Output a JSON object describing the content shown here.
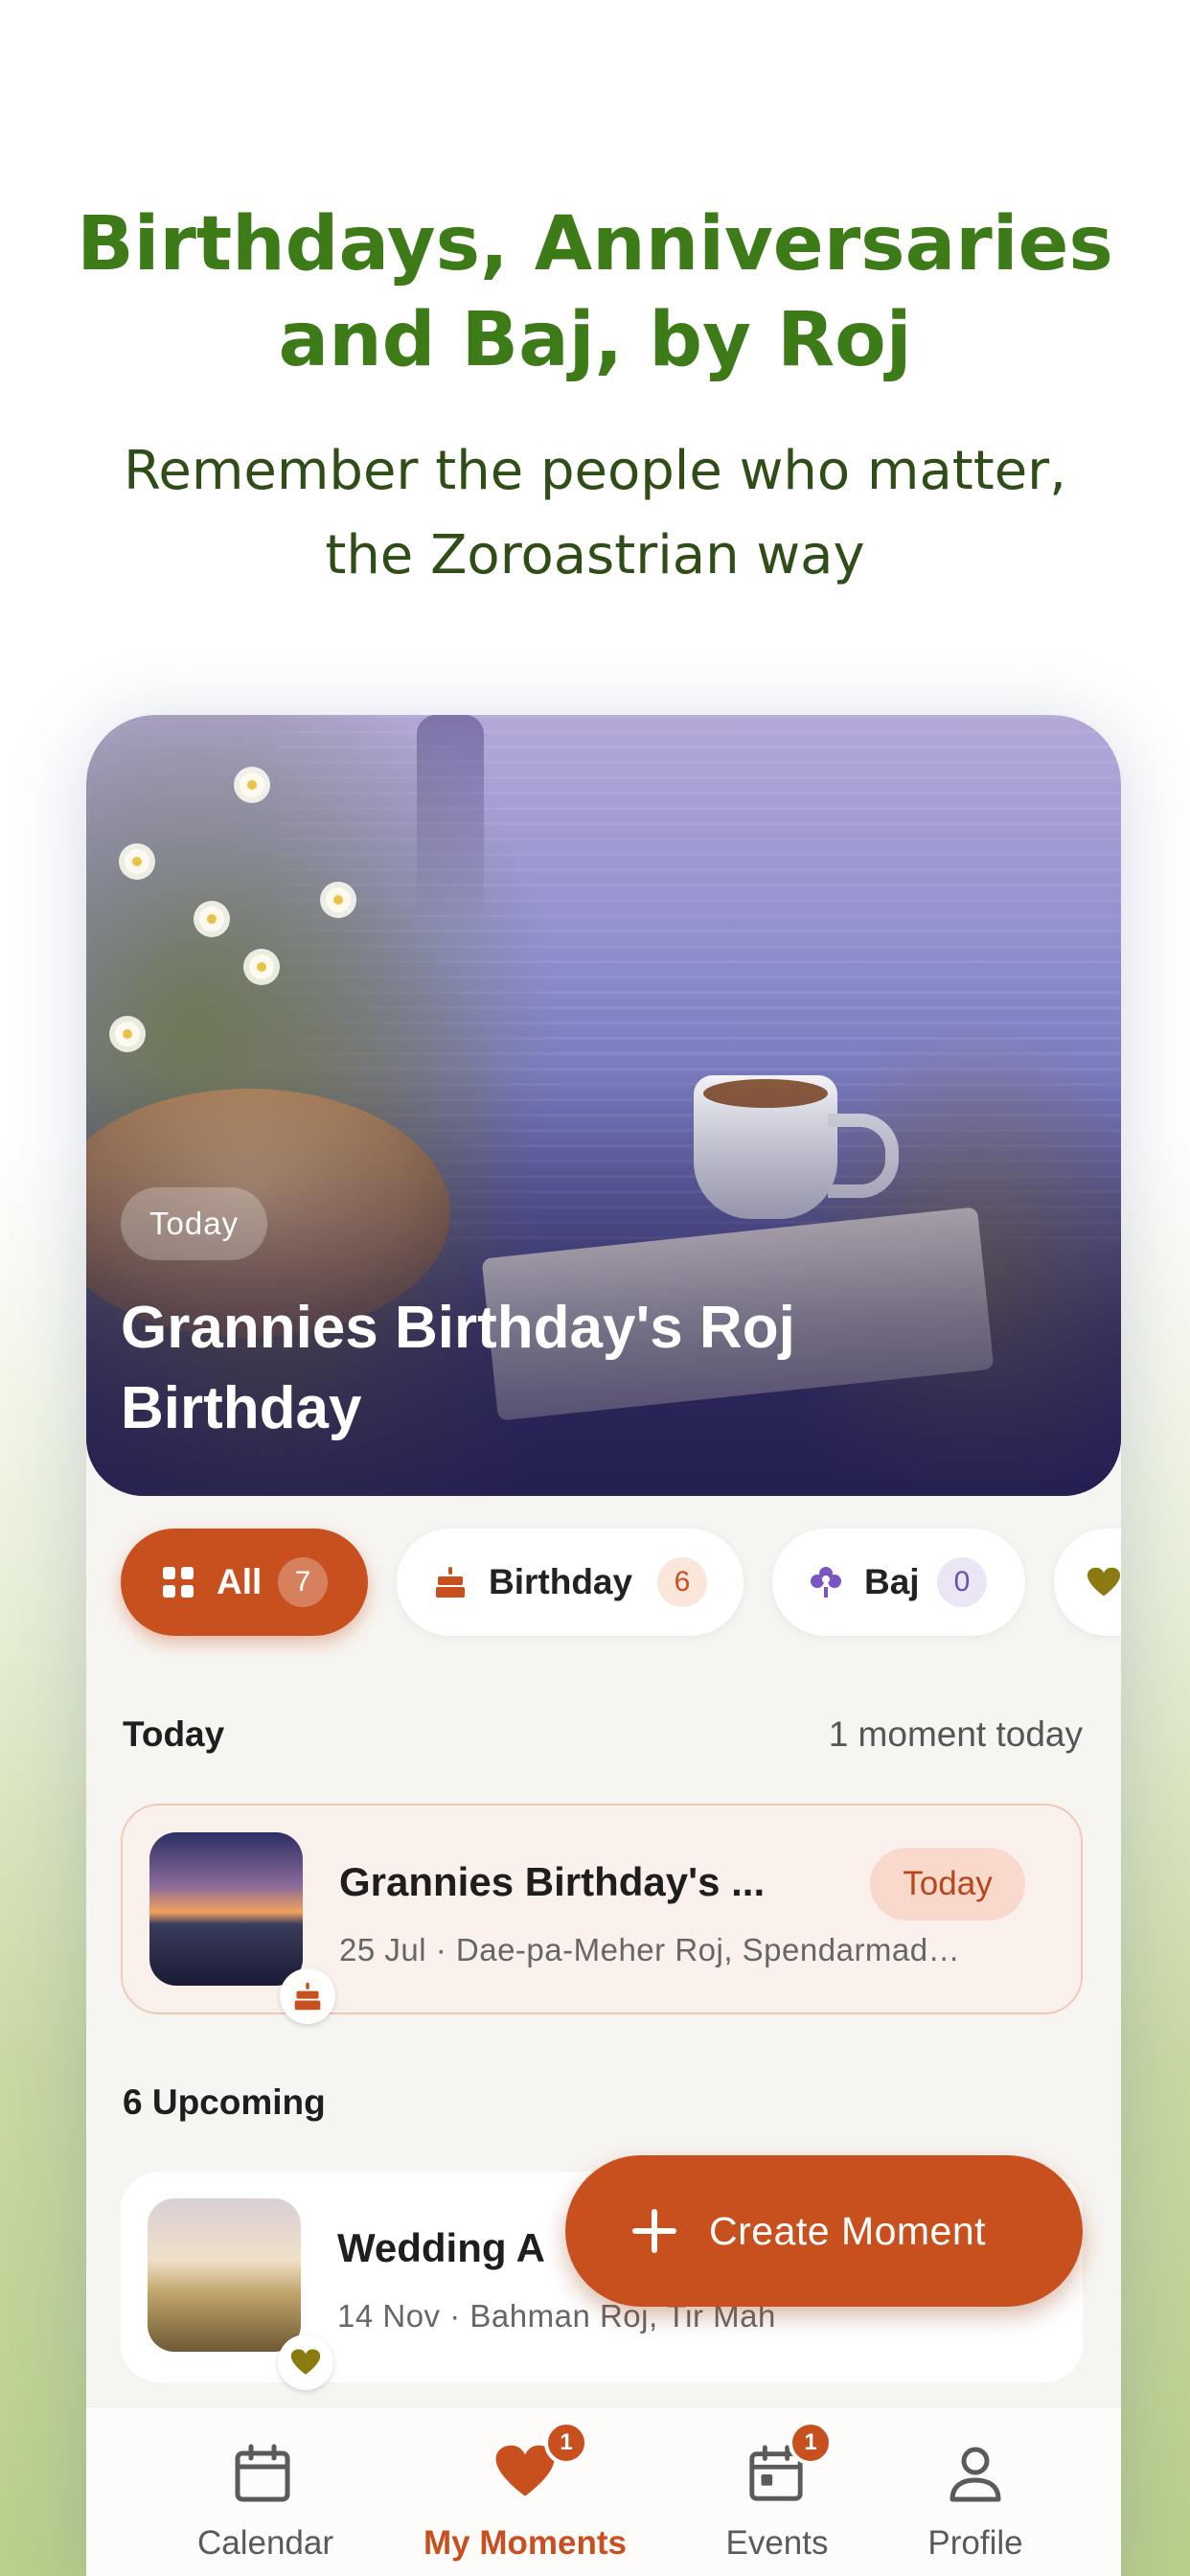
{
  "promo": {
    "title_line1": "Birthdays, Anniversaries",
    "title_line2": "and Baj, by Roj",
    "subtitle_line1": "Remember the people who matter,",
    "subtitle_line2": "the Zoroastrian way"
  },
  "hero": {
    "chip": "Today",
    "title": "Grannies Birthday's Roj Birthday"
  },
  "filters": [
    {
      "label": "All",
      "count": "7",
      "icon": "grid-icon",
      "selected": true
    },
    {
      "label": "Birthday",
      "count": "6",
      "icon": "cake-icon"
    },
    {
      "label": "Baj",
      "count": "0",
      "icon": "flower-icon"
    },
    {
      "label": "",
      "count": "",
      "icon": "heart-icon"
    }
  ],
  "today_section": {
    "heading": "Today",
    "meta": "1 moment today",
    "card": {
      "title": "Grannies Birthday's ...",
      "subtitle": "25 Jul · Dae-pa-Meher Roj, Spendarmad…",
      "pill": "Today",
      "badge_icon": "cake-icon"
    }
  },
  "upcoming_section": {
    "heading": "6 Upcoming",
    "card": {
      "title": "Wedding A",
      "subtitle": "14 Nov · Bahman Roj, Tir Mah",
      "badge_icon": "heart-icon"
    }
  },
  "fab": {
    "label": "Create Moment",
    "icon": "plus-icon"
  },
  "tabbar": [
    {
      "label": "Calendar",
      "icon": "calendar-icon"
    },
    {
      "label": "My Moments",
      "icon": "heart-icon",
      "badge": "1",
      "active": true
    },
    {
      "label": "Events",
      "icon": "event-calendar-icon",
      "badge": "1"
    },
    {
      "label": "Profile",
      "icon": "person-icon"
    }
  ],
  "colors": {
    "accent": "#c8501f",
    "promo_title": "#3d7a18",
    "promo_subtitle": "#2f4d17"
  }
}
